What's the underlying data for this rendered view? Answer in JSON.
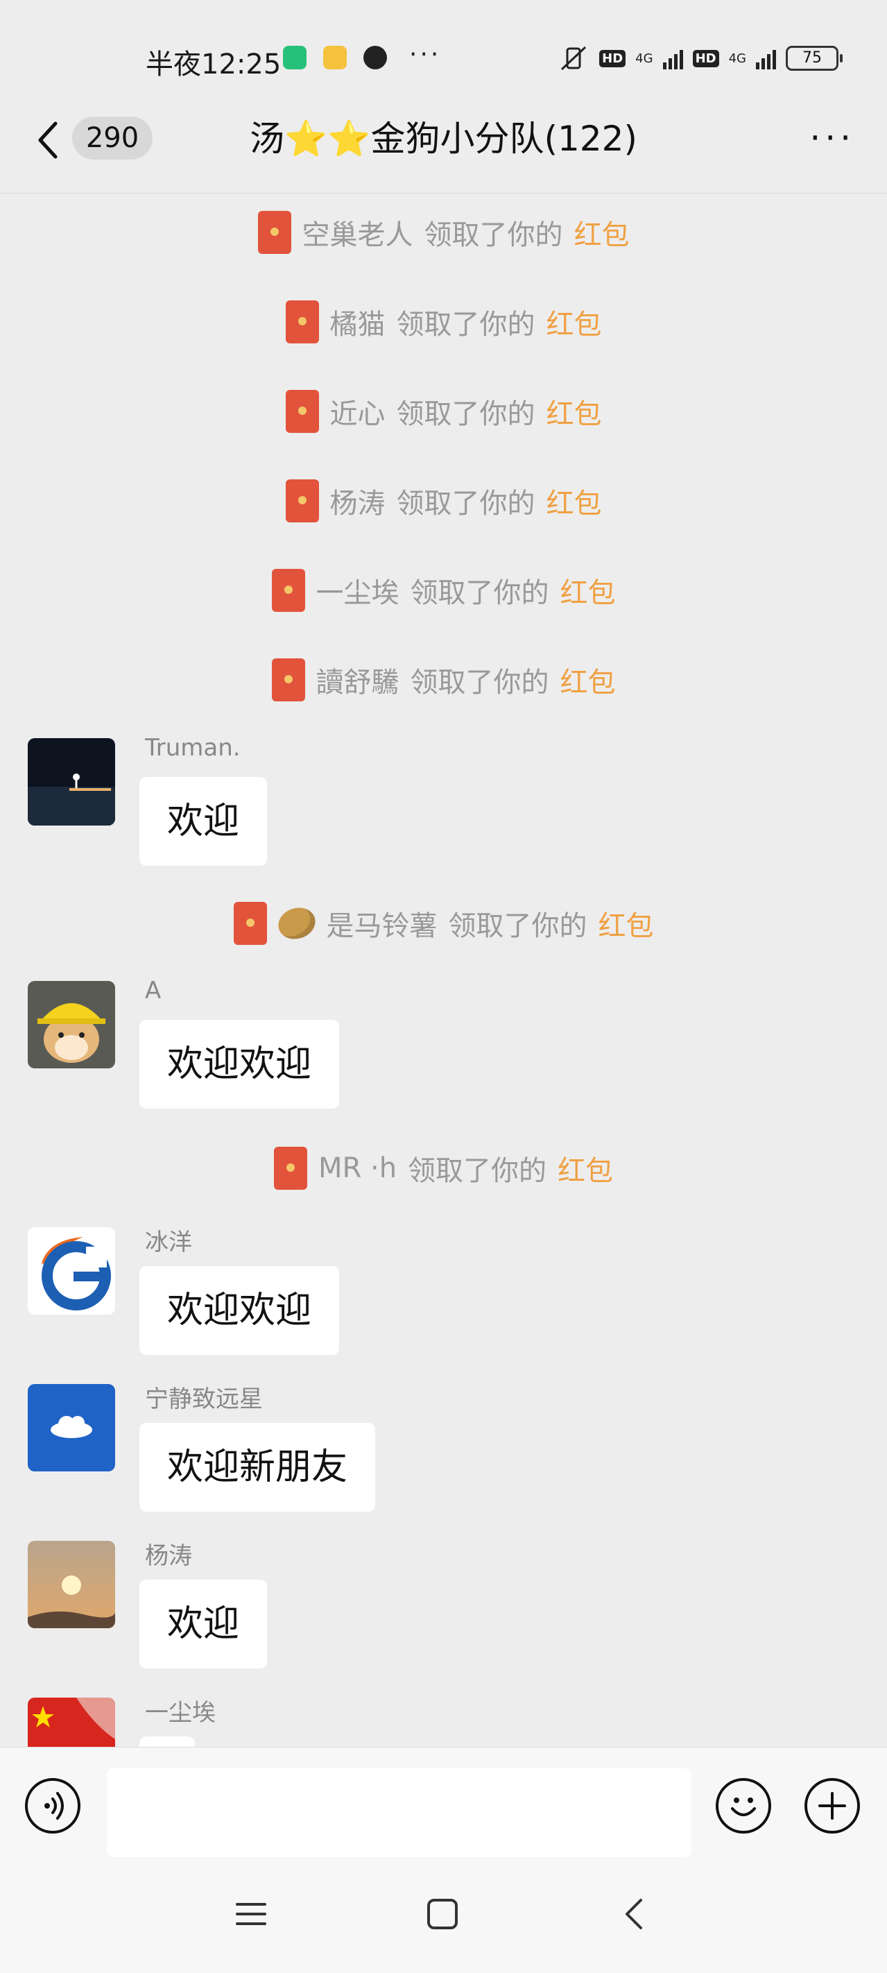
{
  "status_bar": {
    "time": "半夜12:25",
    "dots": "···",
    "network_1": "4G",
    "network_2": "4G",
    "hd": "HD",
    "battery": "75"
  },
  "header": {
    "back_count": "290",
    "title": "汤⭐⭐金狗小分队(122)",
    "more": "···"
  },
  "system_messages": [
    {
      "who": "空巢老人",
      "text": "领取了你的",
      "highlight": "红包"
    },
    {
      "who": "橘猫",
      "text": "领取了你的",
      "highlight": "红包"
    },
    {
      "who": "近心",
      "text": "领取了你的",
      "highlight": "红包"
    },
    {
      "who": "杨涛",
      "text": "领取了你的",
      "highlight": "红包"
    },
    {
      "who": "一尘埃",
      "text": "领取了你的",
      "highlight": "红包"
    },
    {
      "who": "讀舒驣",
      "text": "领取了你的",
      "highlight": "红包"
    },
    {
      "who": "是马铃薯",
      "text": "领取了你的",
      "highlight": "红包"
    },
    {
      "who": "MR ·h ",
      "text": "领取了你的",
      "highlight": "红包"
    }
  ],
  "messages": [
    {
      "nickname": "Truman.",
      "text": "欢迎"
    },
    {
      "nickname": "A",
      "text": "欢迎欢迎"
    },
    {
      "nickname": "冰洋",
      "text": "欢迎欢迎"
    },
    {
      "nickname": "宁静致远星",
      "text": "欢迎新朋友"
    },
    {
      "nickname": "杨涛",
      "text": "欢迎"
    },
    {
      "nickname": "一尘埃",
      "text": ""
    }
  ],
  "colors": {
    "background": "#ededed",
    "red_packet": "#e2533b",
    "highlight": "#f0a043",
    "bubble": "#ffffff"
  }
}
